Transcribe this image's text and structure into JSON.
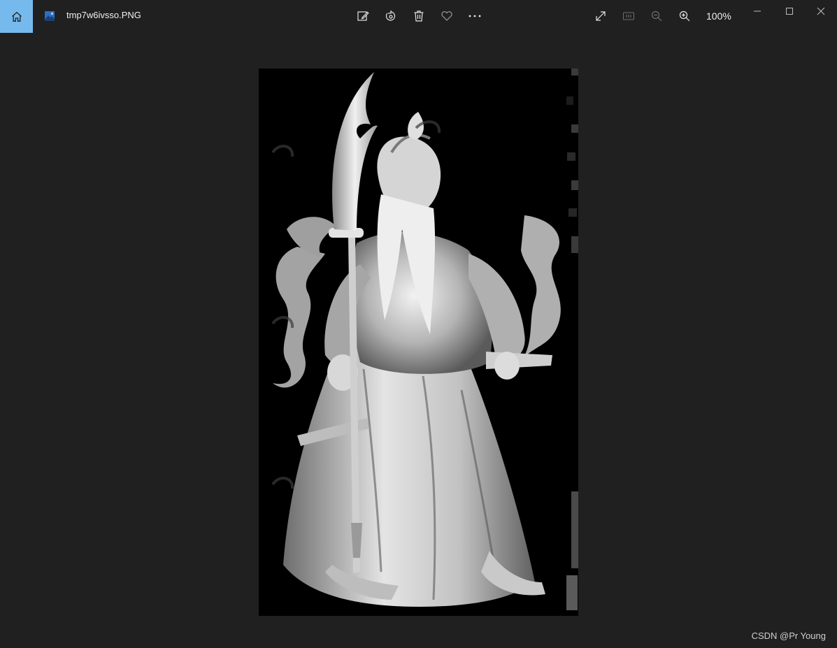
{
  "app": {
    "file_name": "tmp7w6ivsso.PNG",
    "zoom": "100%",
    "accent_color": "#76b9ed"
  },
  "toolbar": {
    "center_icons": [
      "edit-image-icon",
      "rotate-icon",
      "delete-icon",
      "favorite-heart-icon",
      "more-options-icon"
    ],
    "right_icons": [
      "fullscreen-icon",
      "actual-size-icon",
      "zoom-out-icon",
      "zoom-in-icon"
    ]
  },
  "window_controls": [
    "minimize-icon",
    "maximize-icon",
    "close-icon"
  ],
  "watermark": "CSDN @Pr Young"
}
